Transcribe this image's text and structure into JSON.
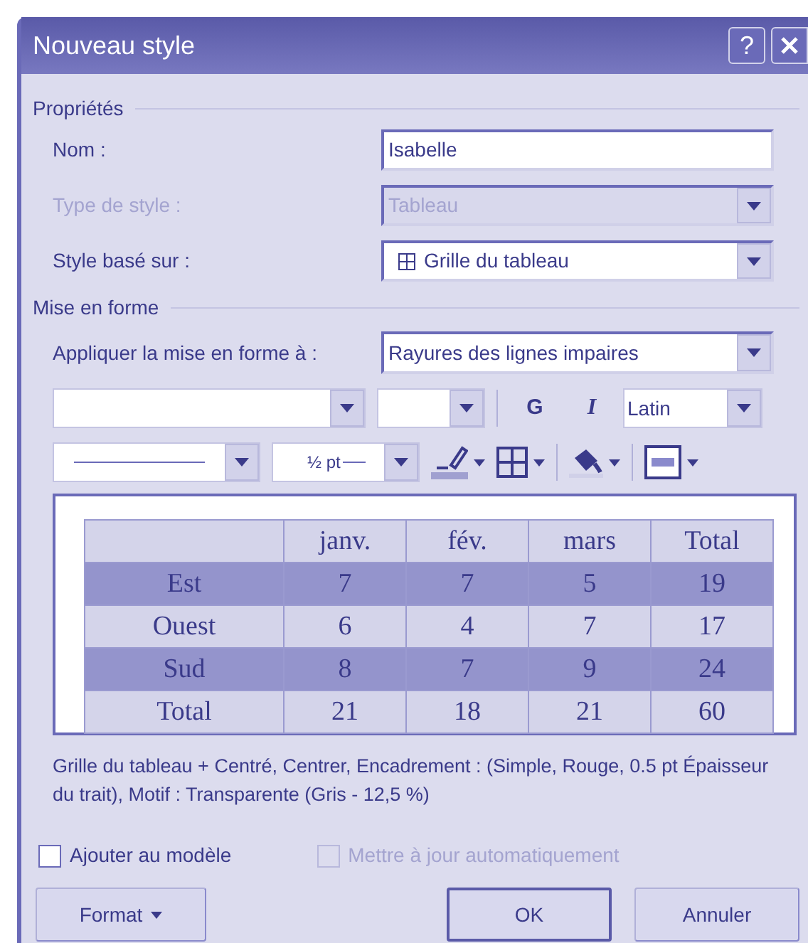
{
  "window": {
    "title": "Nouveau style",
    "help": "?"
  },
  "properties": {
    "title": "Propriétés",
    "fields": [
      {
        "label": "Nom :",
        "value": "Isabelle",
        "kind": "text",
        "disabled": false
      },
      {
        "label": "Type de style :",
        "value": "Tableau",
        "kind": "dropdown",
        "disabled": true
      },
      {
        "label": "Style basé sur :",
        "value": "Grille du tableau",
        "kind": "grid-dropdown",
        "disabled": false
      }
    ]
  },
  "formatting": {
    "title": "Mise en forme",
    "apply_label": "Appliquer la mise en forme à :",
    "apply_value": "Rayures des lignes impaires",
    "toolbar_1": [
      {
        "kind": "font-combo"
      },
      {
        "kind": "size-combo"
      },
      {
        "kind": "separator"
      },
      {
        "kind": "bold",
        "text": "G"
      },
      {
        "kind": "italic",
        "text": "I"
      },
      {
        "kind": "script-combo",
        "value": "Latin"
      }
    ],
    "toolbar_2": [
      {
        "kind": "line-combo"
      },
      {
        "kind": "weight-combo",
        "value": "½ pt"
      },
      {
        "kind": "pen"
      },
      {
        "kind": "borders"
      },
      {
        "kind": "separator"
      },
      {
        "kind": "fill"
      },
      {
        "kind": "separator"
      },
      {
        "kind": "frame"
      }
    ]
  },
  "preview": {
    "columns": [
      "",
      "janv.",
      "fév.",
      "mars",
      "Total"
    ],
    "rows": [
      {
        "shaded": true,
        "cells": [
          "Est",
          "7",
          "7",
          "5",
          "19"
        ]
      },
      {
        "shaded": false,
        "cells": [
          "Ouest",
          "6",
          "4",
          "7",
          "17"
        ]
      },
      {
        "shaded": true,
        "cells": [
          "Sud",
          "8",
          "7",
          "9",
          "24"
        ]
      },
      {
        "shaded": false,
        "cells": [
          "Total",
          "21",
          "18",
          "21",
          "60"
        ]
      }
    ]
  },
  "description": "Grille du tableau + Centré, Centrer, Encadrement : (Simple, Rouge, 0.5 pt Épaisseur du trait), Motif : Transparente (Gris - 12,5 %)",
  "options": [
    {
      "label": "Ajouter au modèle",
      "checked": false,
      "disabled": false
    },
    {
      "label": "Mettre à jour automatiquement",
      "checked": false,
      "disabled": true
    }
  ],
  "buttons": [
    {
      "label": "Format",
      "kind": "menu",
      "default": false
    },
    {
      "label": "OK",
      "kind": "plain",
      "default": true
    },
    {
      "label": "Annuler",
      "kind": "plain",
      "default": false
    }
  ]
}
